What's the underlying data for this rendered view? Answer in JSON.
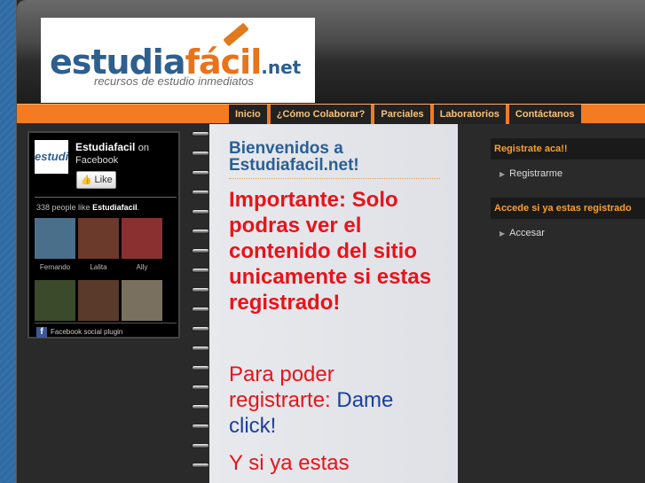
{
  "logo": {
    "part1": "estudia",
    "part2": "fácil",
    "part3": ".net",
    "tagline": "recursos de estudio inmediatos"
  },
  "nav": [
    "Inicio",
    "¿Cómo Colaborar?",
    "Parciales",
    "Laboratorios",
    "Contáctanos"
  ],
  "facebook": {
    "page_name": "Estudiafacil",
    "on": "on",
    "network": "Facebook",
    "like_label": "Like",
    "count_prefix": "338 people like",
    "count_page": "Estudiafacil",
    "faces": [
      {
        "name": "Fernando",
        "color": "#4a6f8a"
      },
      {
        "name": "Lalita",
        "color": "#6b3a2a"
      },
      {
        "name": "Ally",
        "color": "#8a3030"
      },
      {
        "name": "",
        "color": "#3a4a2a"
      },
      {
        "name": "",
        "color": "#5a3a2a"
      },
      {
        "name": "",
        "color": "#7a7060"
      }
    ],
    "footer": "Facebook social plugin"
  },
  "main": {
    "title": "Bienvenidos a Estudiafacil.net!",
    "important": "Importante: Solo podras ver el contenido del sitio unicamente si estas registrado!",
    "register_text": "Para poder registrarte:",
    "register_link": "Dame click!",
    "already_text": "Y si ya estas"
  },
  "sidebar": {
    "register_heading": "Registrate aca!!",
    "register_link": "Registrarme",
    "login_heading": "Accede si ya estas registrado",
    "login_link": "Accesar"
  },
  "colors": {
    "accent_orange": "#f47b20",
    "heading_blue": "#2a5f96",
    "important_red": "#e8131a",
    "link_blue": "#1a3f9f"
  }
}
